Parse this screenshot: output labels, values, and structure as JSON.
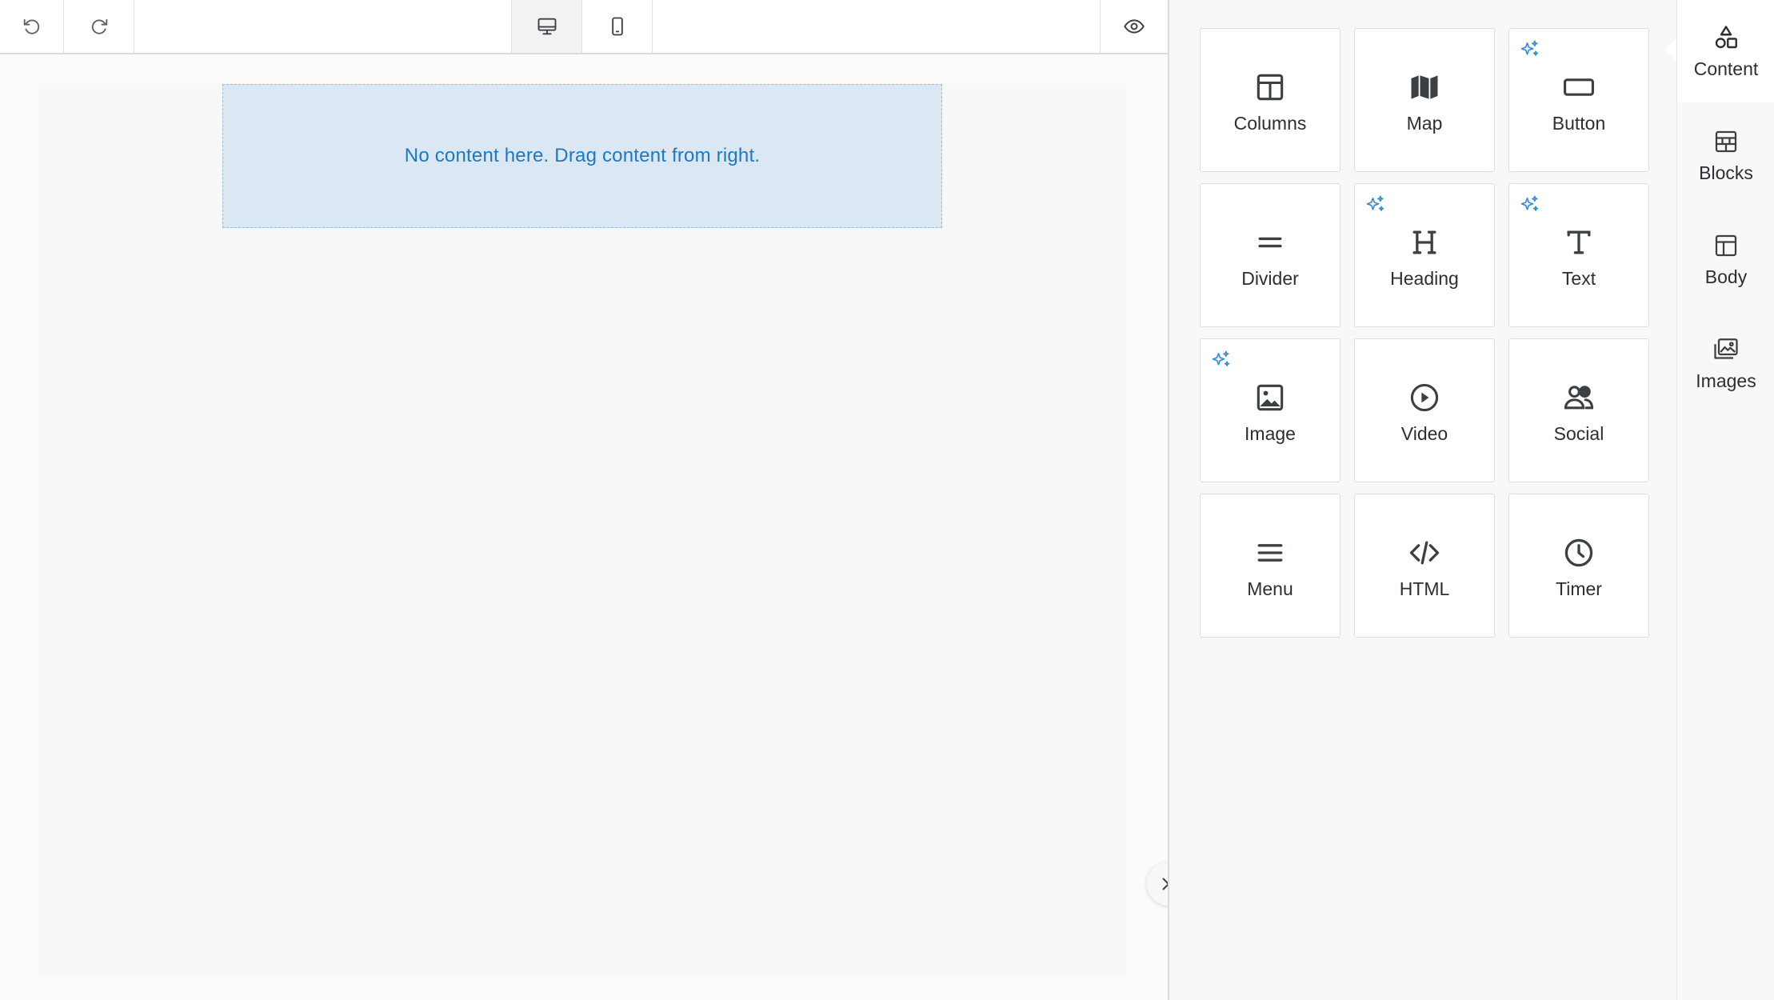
{
  "canvas": {
    "empty_message": "No content here. Drag content from right."
  },
  "content_tools": [
    {
      "label": "Columns",
      "icon": "columns-icon",
      "ai": false
    },
    {
      "label": "Map",
      "icon": "map-icon",
      "ai": false
    },
    {
      "label": "Button",
      "icon": "button-icon",
      "ai": true
    },
    {
      "label": "Divider",
      "icon": "divider-icon",
      "ai": false
    },
    {
      "label": "Heading",
      "icon": "heading-icon",
      "ai": true
    },
    {
      "label": "Text",
      "icon": "text-icon",
      "ai": true
    },
    {
      "label": "Image",
      "icon": "image-icon",
      "ai": true
    },
    {
      "label": "Video",
      "icon": "video-icon",
      "ai": false
    },
    {
      "label": "Social",
      "icon": "social-icon",
      "ai": false
    },
    {
      "label": "Menu",
      "icon": "menu-icon",
      "ai": false
    },
    {
      "label": "HTML",
      "icon": "code-icon",
      "ai": false
    },
    {
      "label": "Timer",
      "icon": "clock-icon",
      "ai": false
    }
  ],
  "tabs": [
    {
      "label": "Content",
      "icon": "shapes-icon",
      "active": true
    },
    {
      "label": "Blocks",
      "icon": "blocks-icon",
      "active": false
    },
    {
      "label": "Body",
      "icon": "layout-icon",
      "active": false
    },
    {
      "label": "Images",
      "icon": "images-icon",
      "active": false
    }
  ],
  "colors": {
    "accent": "#1b78c4",
    "dropzone_bg": "#dbe8f3",
    "sparkle": "#2f8fd6"
  }
}
